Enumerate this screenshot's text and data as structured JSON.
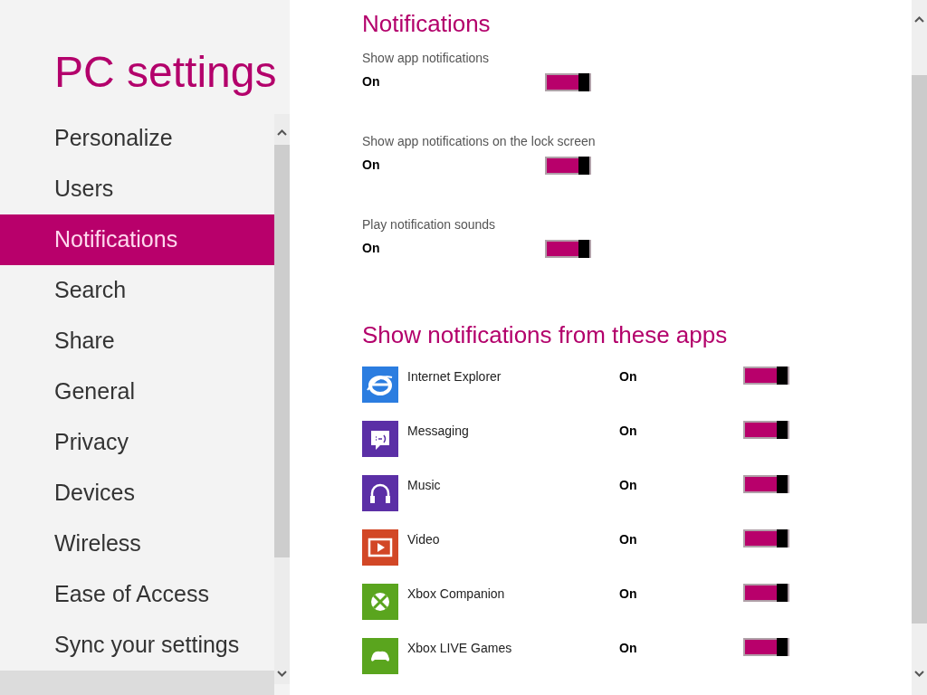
{
  "sidebar": {
    "title": "PC settings",
    "items": [
      {
        "label": "Personalize",
        "selected": false
      },
      {
        "label": "Users",
        "selected": false
      },
      {
        "label": "Notifications",
        "selected": true
      },
      {
        "label": "Search",
        "selected": false
      },
      {
        "label": "Share",
        "selected": false
      },
      {
        "label": "General",
        "selected": false
      },
      {
        "label": "Privacy",
        "selected": false
      },
      {
        "label": "Devices",
        "selected": false
      },
      {
        "label": "Wireless",
        "selected": false
      },
      {
        "label": "Ease of Access",
        "selected": false
      },
      {
        "label": "Sync your settings",
        "selected": false
      }
    ]
  },
  "heading": "Notifications",
  "settings": [
    {
      "label": "Show app notifications",
      "value": "On",
      "on": true
    },
    {
      "label": "Show app notifications on the lock screen",
      "value": "On",
      "on": true
    },
    {
      "label": "Play notification sounds",
      "value": "On",
      "on": true
    }
  ],
  "apps_heading": "Show notifications from these apps",
  "apps": [
    {
      "kind": "browser",
      "name": "Internet Explorer",
      "value": "On",
      "on": true
    },
    {
      "kind": "messaging",
      "name": "Messaging",
      "value": "On",
      "on": true
    },
    {
      "kind": "music",
      "name": "Music",
      "value": "On",
      "on": true
    },
    {
      "kind": "video",
      "name": "Video",
      "value": "On",
      "on": true
    },
    {
      "kind": "xbox",
      "name": "Xbox Companion",
      "value": "On",
      "on": true
    },
    {
      "kind": "games",
      "name": "Xbox LIVE Games",
      "value": "On",
      "on": true
    }
  ]
}
